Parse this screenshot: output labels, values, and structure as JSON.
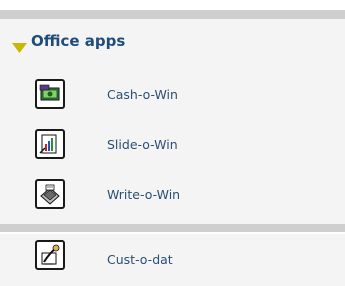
{
  "group": {
    "label": "Office apps",
    "expanded_icon": "triangle-down-icon",
    "accent_color": "#c8b800",
    "items": [
      {
        "label": "Cash-o-Win",
        "icon": "cash-icon"
      },
      {
        "label": "Slide-o-Win",
        "icon": "slide-icon"
      },
      {
        "label": "Write-o-Win",
        "icon": "write-icon"
      }
    ]
  },
  "extra_items": [
    {
      "label": "Cust-o-dat",
      "icon": "cust-icon"
    }
  ]
}
